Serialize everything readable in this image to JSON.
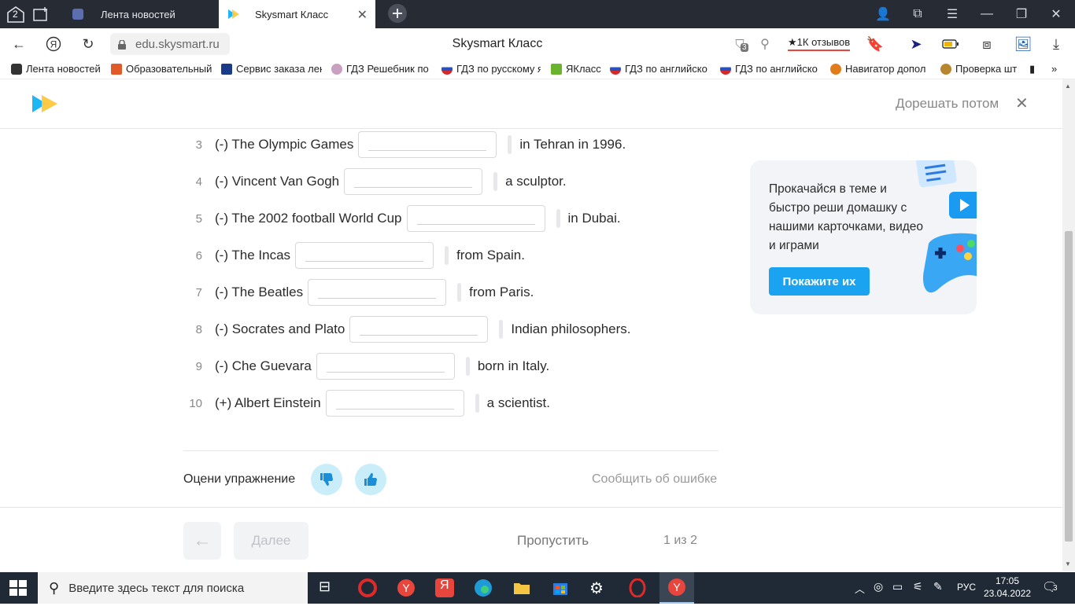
{
  "browser": {
    "tab_count_badge": "2",
    "tabs": [
      {
        "label": "Лента новостей",
        "active": false
      },
      {
        "label": "Skysmart Класс",
        "active": true
      }
    ],
    "url": "edu.skysmart.ru",
    "page_title": "Skysmart Класс",
    "reviews": "1К отзывов",
    "notif_count": "3"
  },
  "bookmarks": [
    {
      "label": "Лента новостей",
      "color": "#ffffff"
    },
    {
      "label": "Образовательный",
      "color": "#e05a2a"
    },
    {
      "label": "Сервис заказа лек",
      "color": "#1a3a8a"
    },
    {
      "label": "ГДЗ Решебник по",
      "color": "#c9a0c0"
    },
    {
      "label": "ГДЗ по русскому я",
      "color": "#d42a2a"
    },
    {
      "label": "ЯКласс",
      "color": "#6ab32e"
    },
    {
      "label": "ГДЗ по английско",
      "color": "#d42a2a"
    },
    {
      "label": "ГДЗ по английско",
      "color": "#d42a2a"
    },
    {
      "label": "Навигатор допол",
      "color": "#e27c1a"
    },
    {
      "label": "Проверка шт",
      "color": "#b8862e"
    }
  ],
  "site": {
    "later_label": "Дорешать потом"
  },
  "exercise": {
    "rows": [
      {
        "num": "3",
        "before": "(-) The Olympic Games",
        "after": "in Tehran in 1996."
      },
      {
        "num": "4",
        "before": "(-) Vincent Van Gogh",
        "after": "a sculptor."
      },
      {
        "num": "5",
        "before": "(-) The 2002 football World Cup",
        "after": "in Dubai."
      },
      {
        "num": "6",
        "before": "(-) The Incas",
        "after": "from Spain."
      },
      {
        "num": "7",
        "before": "(-) The Beatles",
        "after": "from Paris."
      },
      {
        "num": "8",
        "before": "(-) Socrates and Plato",
        "after": "Indian philosophers."
      },
      {
        "num": "9",
        "before": "(-) Che Guevara",
        "after": "born in Italy."
      },
      {
        "num": "10",
        "before": "(+) Albert Einstein",
        "after": "a scientist."
      }
    ]
  },
  "promo": {
    "text": "Прокачайся в теме и быстро реши домашку с нашими карточками, видео и играми",
    "button": "Покажите их"
  },
  "rating": {
    "label": "Оцени упражнение",
    "report": "Сообщить об ошибке"
  },
  "footer": {
    "next": "Далее",
    "skip": "Пропустить",
    "pager": "1 из 2"
  },
  "taskbar": {
    "search_placeholder": "Введите здесь текст для поиска",
    "lang": "РУС",
    "time": "17:05",
    "date": "23.04.2022",
    "notifications": "3"
  }
}
